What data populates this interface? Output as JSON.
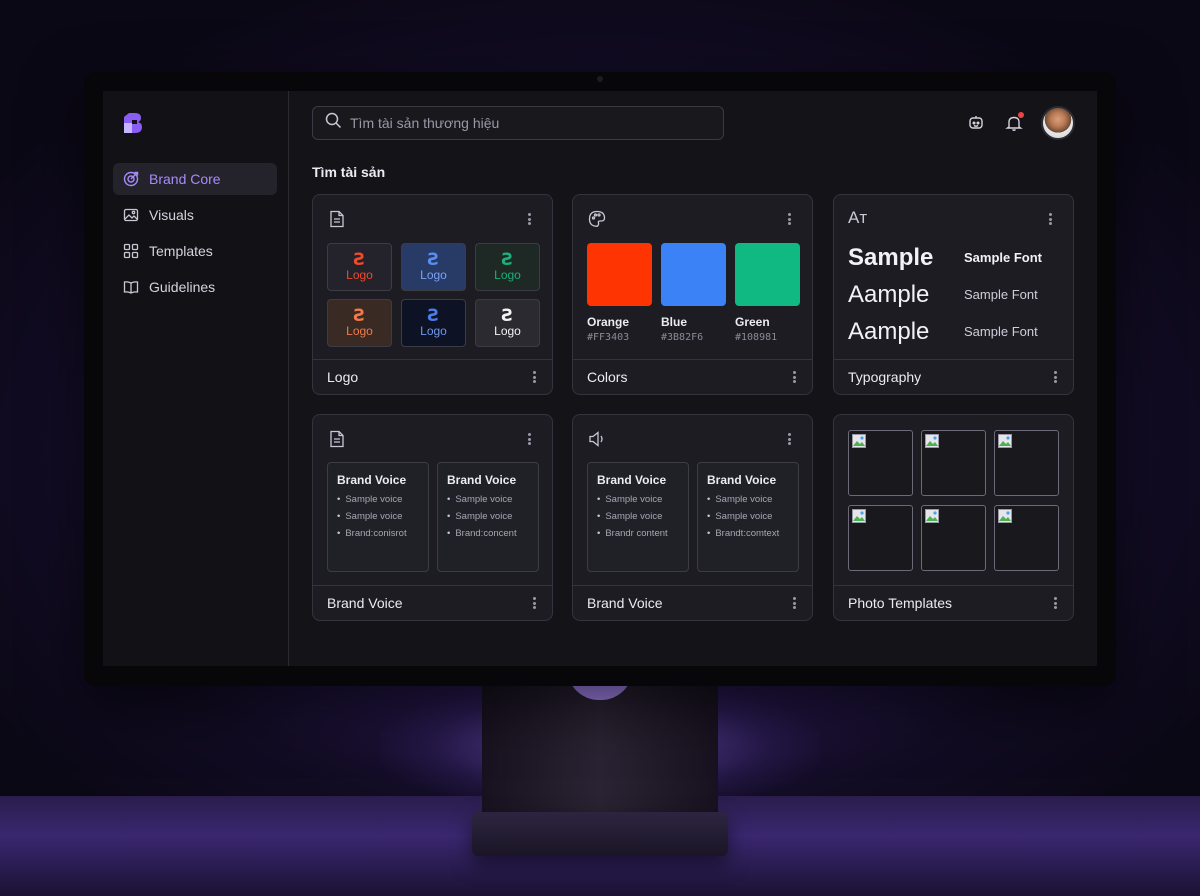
{
  "sidebar": {
    "items": [
      {
        "label": "Brand Core",
        "icon": "target-icon",
        "active": true
      },
      {
        "label": "Visuals",
        "icon": "image-icon",
        "active": false
      },
      {
        "label": "Templates",
        "icon": "grid-icon",
        "active": false
      },
      {
        "label": "Guidelines",
        "icon": "book-icon",
        "active": false
      }
    ]
  },
  "header": {
    "search_placeholder": "Tìm tài sản thương hiệu"
  },
  "main": {
    "section_title": "Tìm tài sản",
    "cards": {
      "logo": {
        "footer": "Logo",
        "tile_label": "Logo",
        "tiles": [
          {
            "label": "Logo",
            "bg": "#24232c",
            "mark_color": "#ef4a2a",
            "text_color": "#ef4a2a"
          },
          {
            "label": "Logo",
            "bg": "#283a66",
            "mark_color": "#5b8cf0",
            "text_color": "#7aa2f5"
          },
          {
            "label": "Logo",
            "bg": "#1e2925",
            "mark_color": "#1fae7a",
            "text_color": "#1fae7a"
          },
          {
            "label": "Logo",
            "bg": "#3a2a24",
            "mark_color": "#f07a4a",
            "text_color": "#f07a4a"
          },
          {
            "label": "Logo",
            "bg": "#0d1224",
            "mark_color": "#4a7de8",
            "text_color": "#6f98f0"
          },
          {
            "label": "Logo",
            "bg": "#2a2a30",
            "mark_color": "#f3f3f5",
            "text_color": "#f3f3f5"
          }
        ]
      },
      "colors": {
        "footer": "Colors",
        "swatches": [
          {
            "name": "Orange",
            "hex": "#FF3403",
            "color": "#FF3403"
          },
          {
            "name": "Blue",
            "hex": "#3B82F6",
            "color": "#3B82F6"
          },
          {
            "name": "Green",
            "hex": "#108981",
            "color": "#10B981"
          }
        ]
      },
      "typography": {
        "footer": "Typography",
        "icon_text": "Aт",
        "rows": [
          {
            "big": "Sample",
            "small": "Sample Font"
          },
          {
            "big": "Aample",
            "small": "Sample Font"
          },
          {
            "big": "Aample",
            "small": "Sample Font"
          }
        ]
      },
      "voice1": {
        "footer": "Brand Voice",
        "panels": [
          {
            "title": "Brand Voice",
            "items": [
              "Sample voice",
              "Sample voice",
              "Brand:conisrot"
            ]
          },
          {
            "title": "Brand Voice",
            "items": [
              "Sample voice",
              "Sample voice",
              "Brand:concent"
            ]
          }
        ]
      },
      "voice2": {
        "footer": "Brand Voice",
        "panels": [
          {
            "title": "Brand Voice",
            "items": [
              "Sample voice",
              "Sample voice",
              "Brandr content"
            ]
          },
          {
            "title": "Brand Voice",
            "items": [
              "Sample voice",
              "Sample voice",
              "Brandt:comtext"
            ]
          }
        ]
      },
      "photos": {
        "footer": "Photo Templates",
        "tile_count": 6
      }
    }
  },
  "colors": {
    "accent": "#a78bfa",
    "notification": "#ef4444"
  }
}
